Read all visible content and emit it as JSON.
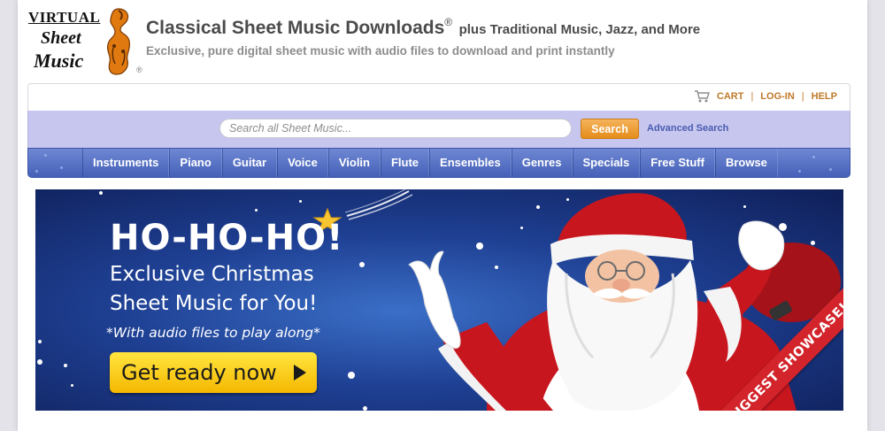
{
  "logo": {
    "line1": "VIRTUAL",
    "line2": "Sheet",
    "line3": "Music",
    "reg": "®"
  },
  "header": {
    "title": "Classical Sheet Music Downloads",
    "title_reg": "®",
    "title_suffix": "plus Traditional Music, Jazz, and More",
    "tagline": "Exclusive, pure digital sheet music with audio files to download and print instantly"
  },
  "toplinks": {
    "cart": "CART",
    "login": "LOG-IN",
    "help": "HELP",
    "separator": "|"
  },
  "search": {
    "placeholder": "Search all Sheet Music...",
    "button": "Search",
    "advanced": "Advanced Search"
  },
  "nav": {
    "items": [
      {
        "label": "Instruments"
      },
      {
        "label": "Piano"
      },
      {
        "label": "Guitar"
      },
      {
        "label": "Voice"
      },
      {
        "label": "Violin"
      },
      {
        "label": "Flute"
      },
      {
        "label": "Ensembles"
      },
      {
        "label": "Genres"
      },
      {
        "label": "Specials"
      },
      {
        "label": "Free Stuff"
      },
      {
        "label": "Browse"
      }
    ]
  },
  "banner": {
    "title": "HO-HO-HO!",
    "sub1": "Exclusive Christmas",
    "sub2": "Sheet Music for You!",
    "note": "*With audio files to play along*",
    "cta": "Get ready now",
    "ribbon": "BIGGEST SHOWCASE!"
  },
  "colors": {
    "accent_orange": "#e48d1c",
    "link_orange": "#c07a2a",
    "nav_blue": "#4560b8",
    "search_band": "#c6c6ee",
    "banner_blue": "#1e3f92",
    "ribbon_red": "#d3242b",
    "cta_yellow": "#f5b800"
  }
}
